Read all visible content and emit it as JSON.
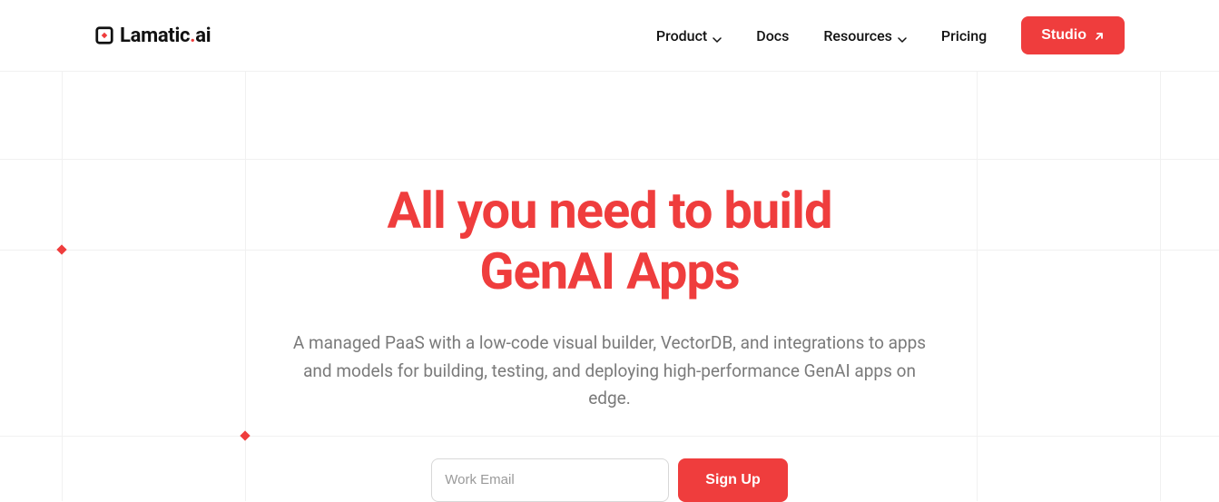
{
  "brand": {
    "name_prefix": "Lamatic",
    "name_suffix": "ai"
  },
  "nav": {
    "items": [
      {
        "label": "Product",
        "has_dropdown": true
      },
      {
        "label": "Docs",
        "has_dropdown": false
      },
      {
        "label": "Resources",
        "has_dropdown": true
      },
      {
        "label": "Pricing",
        "has_dropdown": false
      }
    ],
    "cta_label": "Studio"
  },
  "hero": {
    "title_line1": "All you need to build",
    "title_line2": "GenAI Apps",
    "subtitle": "A managed PaaS with a low-code visual builder, VectorDB, and integrations to apps and models for building, testing, and deploying high-performance GenAI apps on edge."
  },
  "signup": {
    "placeholder": "Work Email",
    "button_label": "Sign Up"
  },
  "colors": {
    "accent": "#ef3d3d",
    "text": "#111111",
    "muted": "#7a7a7a",
    "border": "#f1f1f1"
  }
}
